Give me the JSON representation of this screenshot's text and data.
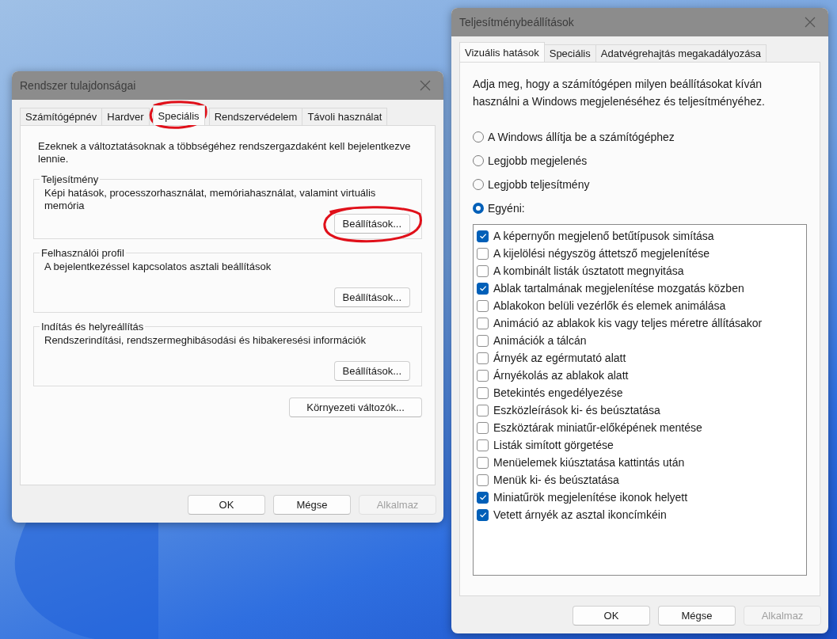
{
  "system_properties": {
    "title": "Rendszer tulajdonságai",
    "tabs": [
      {
        "label": "Számítógépnév",
        "selected": false,
        "circled": false
      },
      {
        "label": "Hardver",
        "selected": false,
        "circled": false
      },
      {
        "label": "Speciális",
        "selected": true,
        "circled": true
      },
      {
        "label": "Rendszervédelem",
        "selected": false,
        "circled": false
      },
      {
        "label": "Távoli használat",
        "selected": false,
        "circled": false
      }
    ],
    "intro": "Ezeknek a változtatásoknak a többségéhez rendszergazdaként kell bejelentkezve lennie.",
    "groups": [
      {
        "legend": "Teljesítmény",
        "text": "Képi hatások, processzorhasználat, memóriahasználat, valamint virtuális memória",
        "button": {
          "label": "Beállítások...",
          "circled": true
        }
      },
      {
        "legend": "Felhasználói profil",
        "text": "A bejelentkezéssel kapcsolatos asztali beállítások",
        "button": {
          "label": "Beállítások...",
          "circled": false
        }
      },
      {
        "legend": "Indítás és helyreállítás",
        "text": "Rendszerindítási, rendszermeghibásodási és hibakeresési információk",
        "button": {
          "label": "Beállítások...",
          "circled": false
        }
      }
    ],
    "extra_button": "Környezeti változók...",
    "buttons": [
      {
        "label": "OK",
        "disabled": false
      },
      {
        "label": "Mégse",
        "disabled": false
      },
      {
        "label": "Alkalmaz",
        "disabled": true
      }
    ]
  },
  "performance_options": {
    "title": "Teljesítménybeállítások",
    "tabs": [
      {
        "label": "Vizuális hatások",
        "selected": true
      },
      {
        "label": "Speciális",
        "selected": false
      },
      {
        "label": "Adatvégrehajtás megakadályozása",
        "selected": false
      }
    ],
    "description": "Adja meg, hogy a számítógépen milyen beállításokat kíván használni a Windows megjelenéséhez és teljesítményéhez.",
    "radios": [
      {
        "label": "A Windows állítja be a számítógéphez",
        "selected": false
      },
      {
        "label": "Legjobb megjelenés",
        "selected": false
      },
      {
        "label": "Legjobb teljesítmény",
        "selected": false
      },
      {
        "label": "Egyéni:",
        "selected": true
      }
    ],
    "checkboxes": [
      {
        "label": "A képernyőn megjelenő betűtípusok simítása",
        "checked": true
      },
      {
        "label": "A kijelölési négyszög áttetsző megjelenítése",
        "checked": false
      },
      {
        "label": "A kombinált listák úsztatott megnyitása",
        "checked": false
      },
      {
        "label": "Ablak tartalmának megjelenítése mozgatás közben",
        "checked": true
      },
      {
        "label": "Ablakokon belüli vezérlők és elemek animálása",
        "checked": false
      },
      {
        "label": "Animáció az ablakok kis vagy teljes méretre állításakor",
        "checked": false
      },
      {
        "label": "Animációk a tálcán",
        "checked": false
      },
      {
        "label": "Árnyék az egérmutató alatt",
        "checked": false
      },
      {
        "label": "Árnyékolás az ablakok alatt",
        "checked": false
      },
      {
        "label": "Betekintés engedélyezése",
        "checked": false
      },
      {
        "label": "Eszközleírások ki- és beúsztatása",
        "checked": false
      },
      {
        "label": "Eszköztárak miniatűr-előképének mentése",
        "checked": false
      },
      {
        "label": "Listák simított görgetése",
        "checked": false
      },
      {
        "label": "Menüelemek kiúsztatása kattintás után",
        "checked": false
      },
      {
        "label": "Menük ki- és beúsztatása",
        "checked": false
      },
      {
        "label": "Miniatűrök megjelenítése ikonok helyett",
        "checked": true
      },
      {
        "label": "Vetett árnyék az asztal ikoncímkéin",
        "checked": true
      }
    ],
    "buttons": [
      {
        "label": "OK",
        "disabled": false
      },
      {
        "label": "Mégse",
        "disabled": false
      },
      {
        "label": "Alkalmaz",
        "disabled": true
      }
    ]
  }
}
